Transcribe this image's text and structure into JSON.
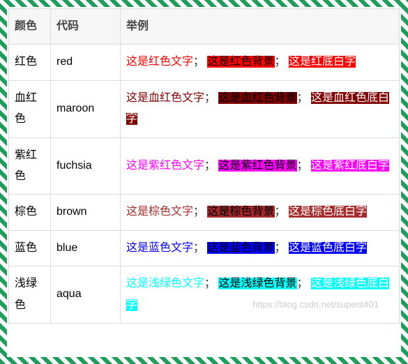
{
  "headers": {
    "col0": "颜色",
    "col1": "代码",
    "col2": "举例"
  },
  "separator": "；",
  "rows": [
    {
      "name": "红色",
      "code": "red",
      "textExample": "这是红色文字",
      "bgExample": "这是红色背景",
      "invExample": "这是红底白字"
    },
    {
      "name": "血红色",
      "code": "maroon",
      "textExample": "这是血红色文字",
      "bgExample": "这是血红色背景",
      "invExample": "这是血红色底白字"
    },
    {
      "name": "紫红色",
      "code": "fuchsia",
      "textExample": "这是紫红色文字",
      "bgExample": "这是紫红色背景",
      "invExample": "这是紫红底白字"
    },
    {
      "name": "棕色",
      "code": "brown",
      "textExample": "这是棕色文字",
      "bgExample": "这是棕色背景",
      "invExample": "这是棕色底白字"
    },
    {
      "name": "蓝色",
      "code": "blue",
      "textExample": "这是蓝色文字",
      "bgExample": "这是蓝色背景",
      "invExample": "这是蓝色底白字"
    },
    {
      "name": "浅绿色",
      "code": "aqua",
      "textExample": "这是浅绿色文字",
      "bgExample": "这是浅绿色背景",
      "invExample": "这是浅绿色底白字"
    }
  ],
  "watermark": "https://blog.csdn.net/superit401"
}
